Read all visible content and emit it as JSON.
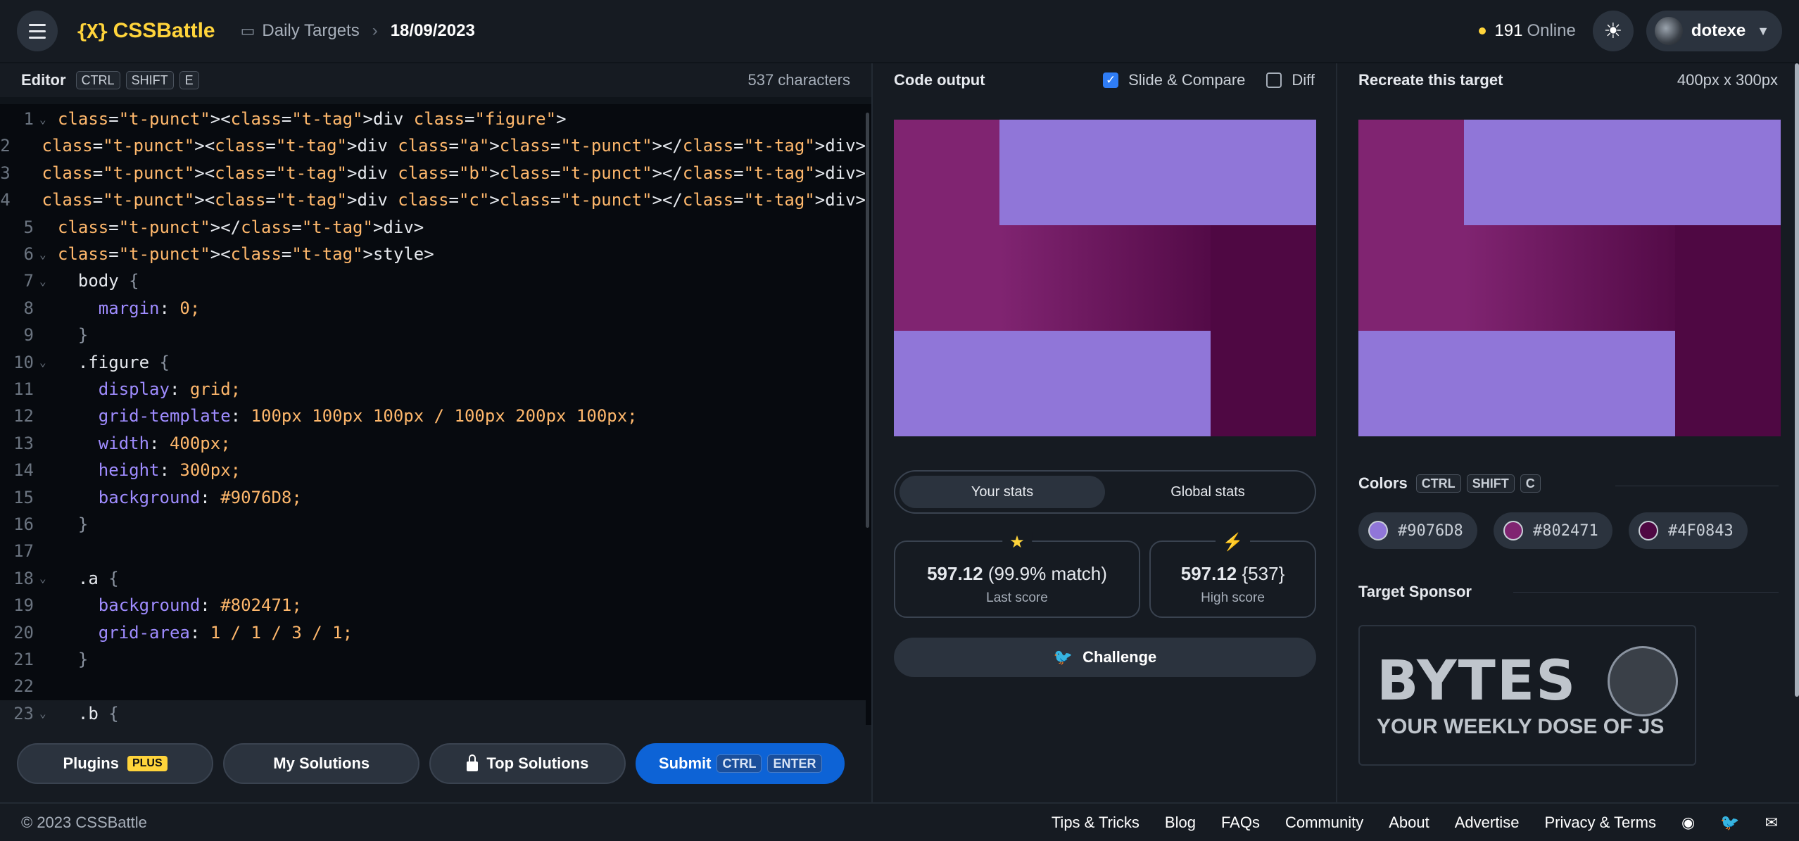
{
  "topbar": {
    "brand": "CSSBattle",
    "brand_mark": "{X}",
    "breadcrumb_section": "Daily Targets",
    "breadcrumb_date": "18/09/2023",
    "online_count": "191",
    "online_label": "Online",
    "user_name": "dotexe"
  },
  "editor": {
    "title": "Editor",
    "shortcut": [
      "CTRL",
      "SHIFT",
      "E"
    ],
    "char_count": "537 characters",
    "lines": [
      {
        "n": "1",
        "fold": true,
        "text": "<div class=\"figure\">"
      },
      {
        "n": "2",
        "fold": false,
        "text": "  <div class=\"a\"></div>"
      },
      {
        "n": "3",
        "fold": false,
        "text": "  <div class=\"b\"></div>"
      },
      {
        "n": "4",
        "fold": false,
        "text": "  <div class=\"c\"></div>"
      },
      {
        "n": "5",
        "fold": false,
        "text": "</div>"
      },
      {
        "n": "6",
        "fold": true,
        "text": "<style>"
      },
      {
        "n": "7",
        "fold": true,
        "text": "  body {"
      },
      {
        "n": "8",
        "fold": false,
        "text": "    margin: 0;"
      },
      {
        "n": "9",
        "fold": false,
        "text": "  }"
      },
      {
        "n": "10",
        "fold": true,
        "text": "  .figure {"
      },
      {
        "n": "11",
        "fold": false,
        "text": "    display: grid;"
      },
      {
        "n": "12",
        "fold": false,
        "text": "    grid-template: 100px 100px 100px / 100px 200px 100px;"
      },
      {
        "n": "13",
        "fold": false,
        "text": "    width: 400px;"
      },
      {
        "n": "14",
        "fold": false,
        "text": "    height: 300px;"
      },
      {
        "n": "15",
        "fold": false,
        "text": "    background: #9076D8;"
      },
      {
        "n": "16",
        "fold": false,
        "text": "  }"
      },
      {
        "n": "17",
        "fold": false,
        "text": ""
      },
      {
        "n": "18",
        "fold": true,
        "text": "  .a {"
      },
      {
        "n": "19",
        "fold": false,
        "text": "    background: #802471;"
      },
      {
        "n": "20",
        "fold": false,
        "text": "    grid-area: 1 / 1 / 3 / 1;"
      },
      {
        "n": "21",
        "fold": false,
        "text": "  }"
      },
      {
        "n": "22",
        "fold": false,
        "text": ""
      },
      {
        "n": "23",
        "fold": true,
        "text": "  .b {"
      }
    ],
    "buttons": {
      "plugins": "Plugins",
      "plugins_badge": "PLUS",
      "my_solutions": "My Solutions",
      "top_solutions": "Top Solutions",
      "submit": "Submit",
      "submit_shortcut": [
        "CTRL",
        "ENTER"
      ]
    }
  },
  "output": {
    "title": "Code output",
    "slide_compare": "Slide & Compare",
    "slide_compare_checked": true,
    "diff": "Diff",
    "diff_checked": false,
    "tabs": [
      "Your stats",
      "Global stats"
    ],
    "last_score_value": "597.12",
    "last_score_match": "(99.9% match)",
    "last_score_label": "Last score",
    "high_score_value": "597.12",
    "high_score_chars": "{537}",
    "high_score_label": "High score",
    "challenge": "Challenge"
  },
  "target": {
    "title": "Recreate this target",
    "dims": "400px x 300px",
    "colors_label": "Colors",
    "colors_shortcut": [
      "CTRL",
      "SHIFT",
      "C"
    ],
    "colors": [
      {
        "hex": "#9076D8"
      },
      {
        "hex": "#802471"
      },
      {
        "hex": "#4F0843"
      }
    ],
    "sponsor_label": "Target Sponsor",
    "sponsor_big": "BYTES",
    "sponsor_small": "YOUR WEEKLY DOSE OF JS"
  },
  "footer": {
    "copyright": "© 2023 CSSBattle",
    "links": [
      "Tips & Tricks",
      "Blog",
      "FAQs",
      "Community",
      "About",
      "Advertise",
      "Privacy & Terms"
    ]
  },
  "icons": [
    "menu-icon",
    "calendar-icon",
    "chevron-right-icon",
    "sun-icon",
    "chevron-down-icon",
    "star-icon",
    "lightning-icon",
    "twitter-icon",
    "discord-icon",
    "mail-icon",
    "lock-icon"
  ]
}
